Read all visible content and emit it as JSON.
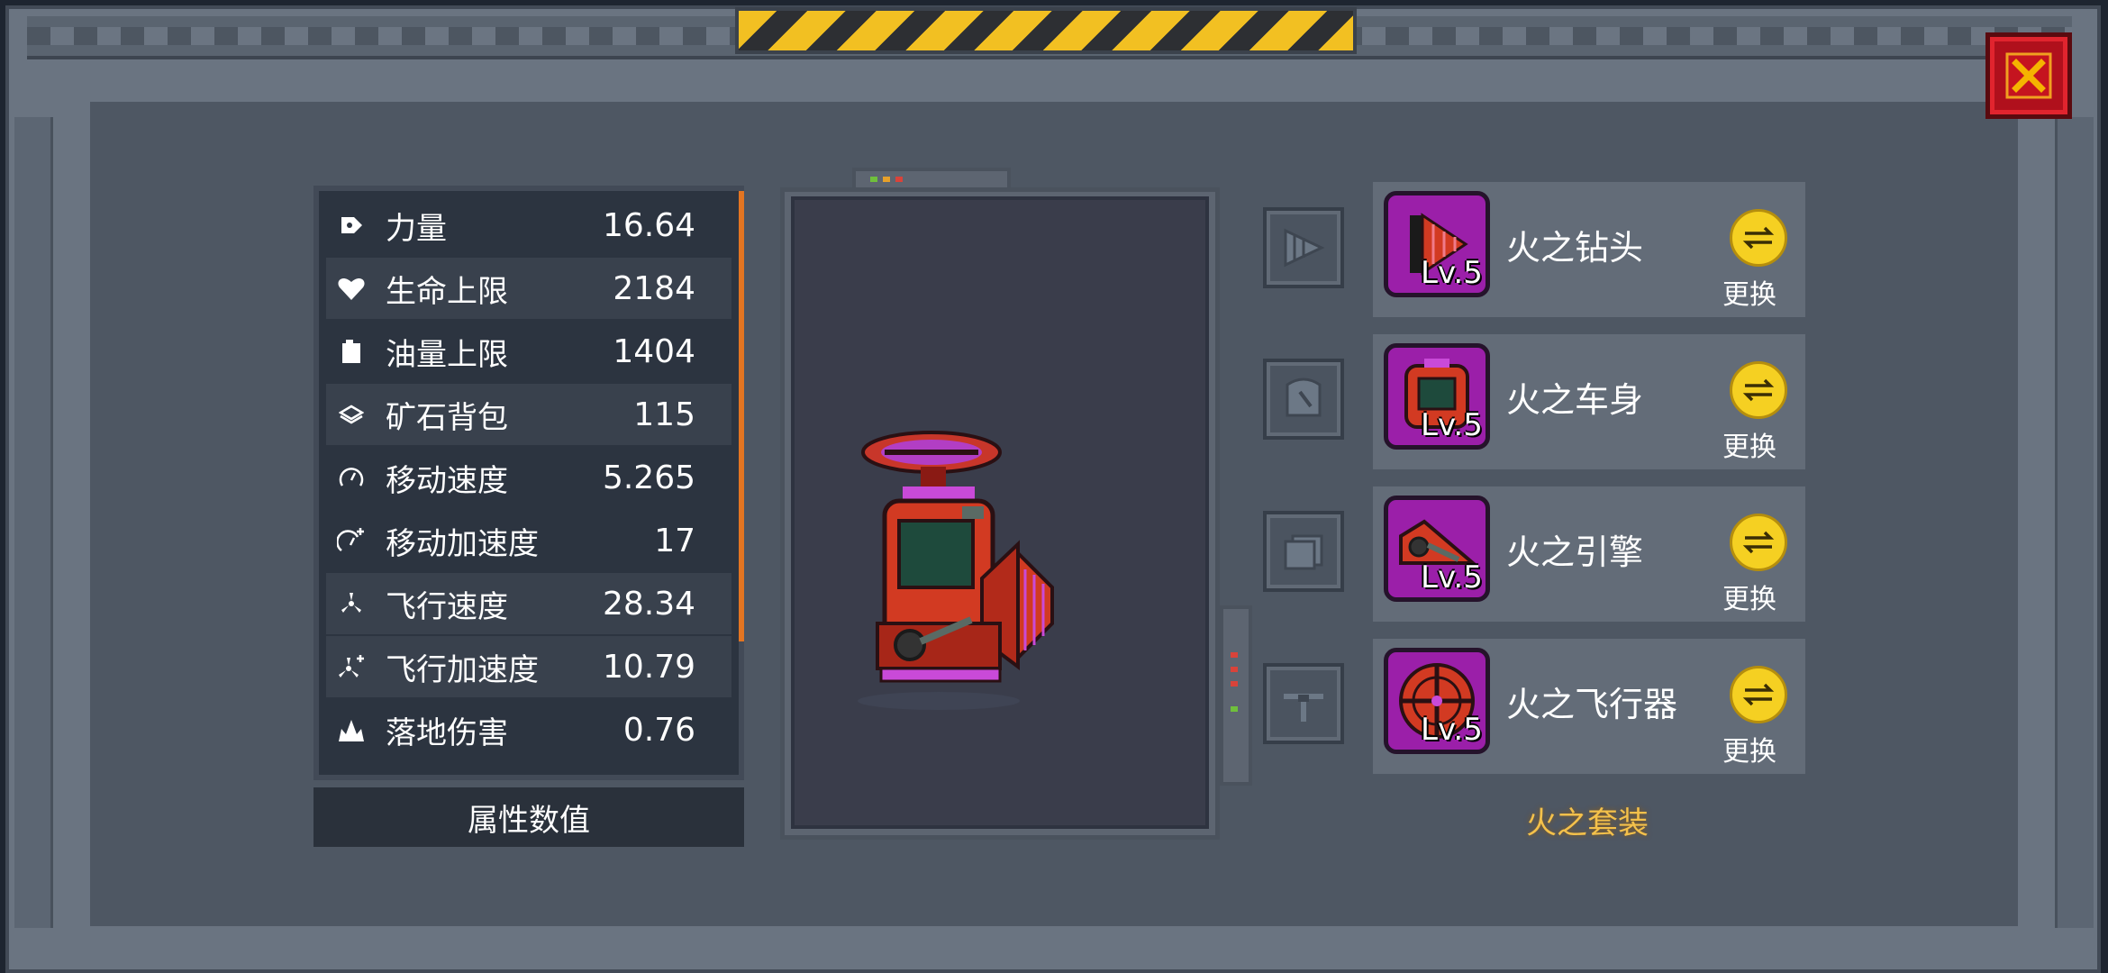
{
  "window": {
    "close_icon": "close-x-icon",
    "colors": {
      "panel": "#4e5763",
      "frame": "#6a7481",
      "close": "#b0101c",
      "accent_scroll": "#e37522",
      "set_gold": "#f4c14b"
    }
  },
  "stats": {
    "rows": [
      {
        "icon": "power-tag-icon",
        "label": "力量",
        "value": "16.64"
      },
      {
        "icon": "heart-icon",
        "label": "生命上限",
        "value": "2184"
      },
      {
        "icon": "fuel-can-icon",
        "label": "油量上限",
        "value": "1404"
      },
      {
        "icon": "ore-bag-icon",
        "label": "矿石背包",
        "value": "115"
      },
      {
        "icon": "speedometer-icon",
        "label": "移动速度",
        "value": "5.265"
      },
      {
        "icon": "speedometer-plus-icon",
        "label": "移动加速度",
        "value": "17"
      },
      {
        "icon": "propeller-icon",
        "label": "飞行速度",
        "value": "28.34"
      },
      {
        "icon": "propeller-plus-icon",
        "label": "飞行加速度",
        "value": "10.79"
      },
      {
        "icon": "impact-icon",
        "label": "落地伤害",
        "value": "0.76"
      }
    ],
    "footer_label": "属性数值"
  },
  "equipment": [
    {
      "slot_icon": "drill-slot-icon",
      "name": "火之钻头",
      "level": "Lv.5",
      "swap_label": "更换"
    },
    {
      "slot_icon": "body-slot-icon",
      "name": "火之车身",
      "level": "Lv.5",
      "swap_label": "更换"
    },
    {
      "slot_icon": "engine-slot-icon",
      "name": "火之引擎",
      "level": "Lv.5",
      "swap_label": "更换"
    },
    {
      "slot_icon": "rotor-slot-icon",
      "name": "火之飞行器",
      "level": "Lv.5",
      "swap_label": "更换"
    }
  ],
  "set_name": "火之套装"
}
